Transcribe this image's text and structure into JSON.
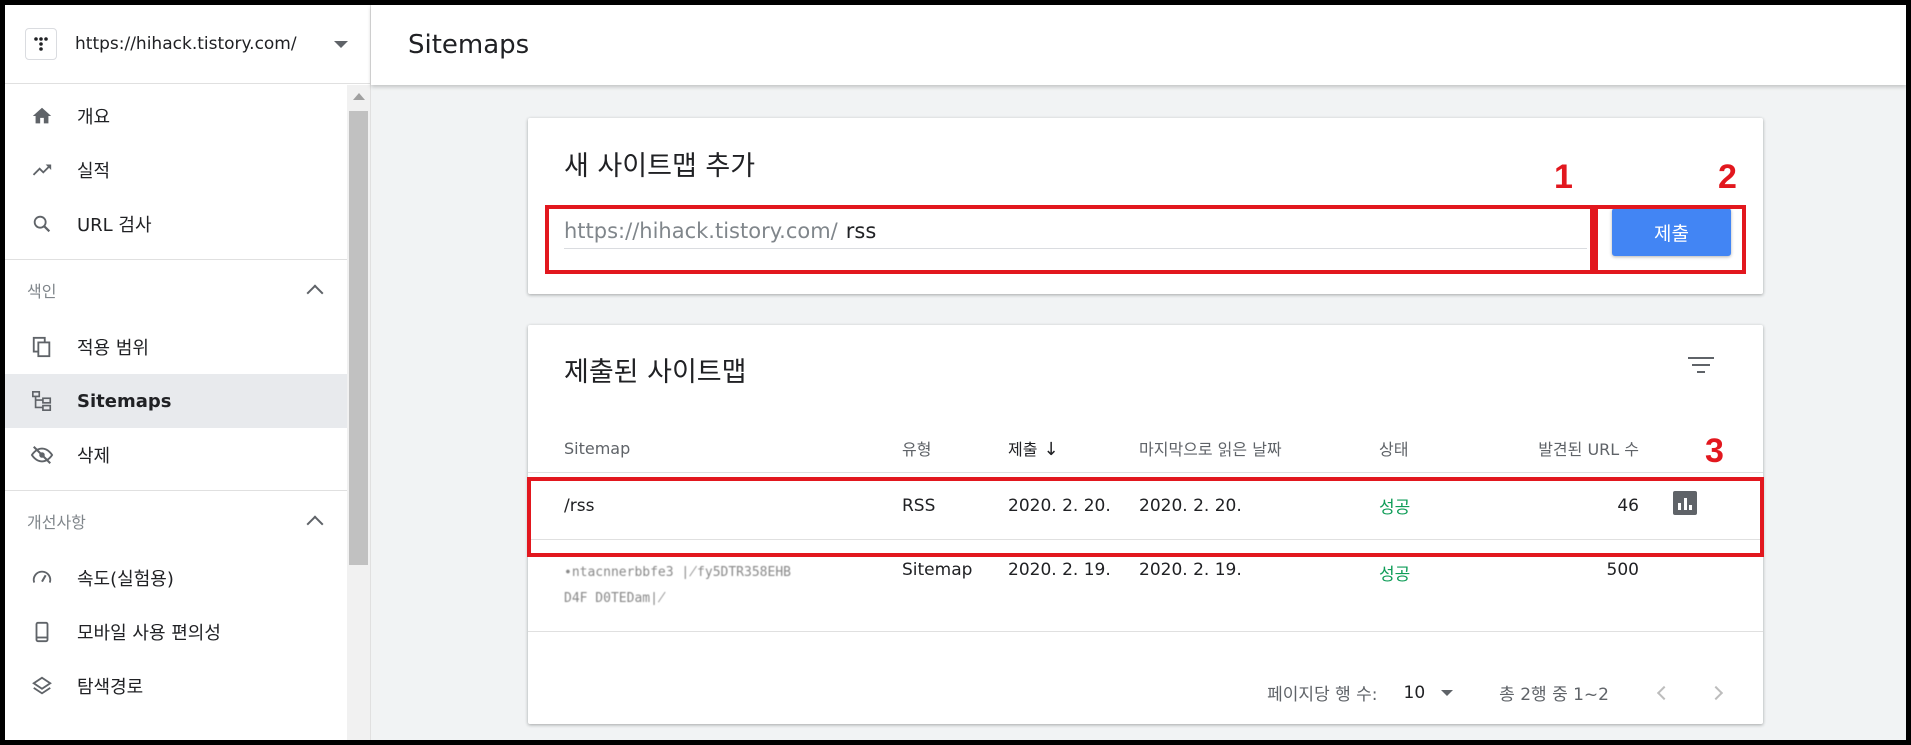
{
  "sidebar": {
    "property_url": "https://hihack.tistory.com/",
    "nav_top": [
      {
        "label": "개요",
        "icon": "home-icon"
      },
      {
        "label": "실적",
        "icon": "trending-up-icon"
      },
      {
        "label": "URL 검사",
        "icon": "search-icon"
      }
    ],
    "index_group": {
      "title": "색인",
      "items": [
        {
          "label": "적용 범위",
          "icon": "copy-icon"
        },
        {
          "label": "Sitemaps",
          "icon": "sitemap-icon"
        },
        {
          "label": "삭제",
          "icon": "visibility-off-icon"
        }
      ]
    },
    "enhancements_group": {
      "title": "개선사항",
      "items": [
        {
          "label": "속도(실험용)",
          "icon": "speed-icon"
        },
        {
          "label": "모바일 사용 편의성",
          "icon": "phone-icon"
        },
        {
          "label": "탐색경로",
          "icon": "layers-icon"
        }
      ]
    }
  },
  "topbar": {
    "title": "Sitemaps"
  },
  "add_card": {
    "title": "새 사이트맵 추가",
    "url_prefix": "https://hihack.tistory.com/",
    "input_value": "rss",
    "submit_label": "제출"
  },
  "submitted_card": {
    "title": "제출된 사이트맵",
    "columns": {
      "sitemap": "Sitemap",
      "type": "유형",
      "submitted": "제출",
      "last_read": "마지막으로 읽은 날짜",
      "status": "상태",
      "urls": "발견된 URL 수"
    },
    "rows": [
      {
        "sitemap": "/rss",
        "type": "RSS",
        "submitted": "2020. 2. 20.",
        "last_read": "2020. 2. 20.",
        "status": "성공",
        "urls": "46"
      },
      {
        "sitemap_line1": "∙ntacnnerbbfe3 ∤fy5DTR358EHB",
        "sitemap_line2": "D4F D0TEDam∤",
        "type": "Sitemap",
        "submitted": "2020. 2. 19.",
        "last_read": "2020. 2. 19.",
        "status": "성공",
        "urls": "500"
      }
    ],
    "pager": {
      "rows_per_page_label": "페이지당 행 수:",
      "rows_per_page": "10",
      "range": "총 2행 중 1~2"
    }
  },
  "annotations": [
    "1",
    "2",
    "3"
  ],
  "colors": {
    "accent": "#4285f4",
    "success": "#0f9d58",
    "annotation": "#e2171e"
  }
}
